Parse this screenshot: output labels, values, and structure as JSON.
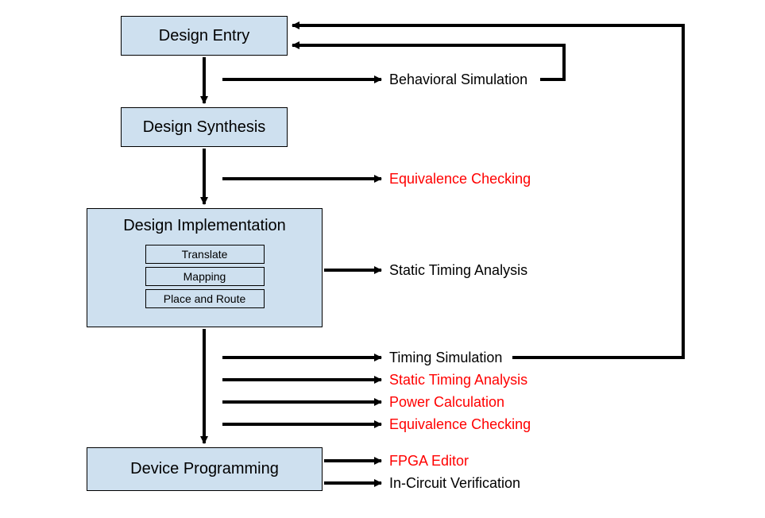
{
  "boxes": {
    "design_entry": "Design Entry",
    "design_synthesis": "Design Synthesis",
    "design_implementation": "Design Implementation",
    "device_programming": "Device Programming"
  },
  "sub_steps": {
    "translate": "Translate",
    "mapping": "Mapping",
    "place_route": "Place and Route"
  },
  "labels": {
    "behavioral_sim": "Behavioral Simulation",
    "equiv_check_1": "Equivalence Checking",
    "static_timing_1": "Static Timing Analysis",
    "timing_sim": "Timing Simulation",
    "static_timing_2": "Static Timing Analysis",
    "power_calc": "Power Calculation",
    "equiv_check_2": "Equivalence Checking",
    "fpga_editor": "FPGA Editor",
    "in_circuit": "In-Circuit Verification"
  },
  "colors": {
    "box_fill": "#cee0ef",
    "highlight": "#ff0000"
  }
}
